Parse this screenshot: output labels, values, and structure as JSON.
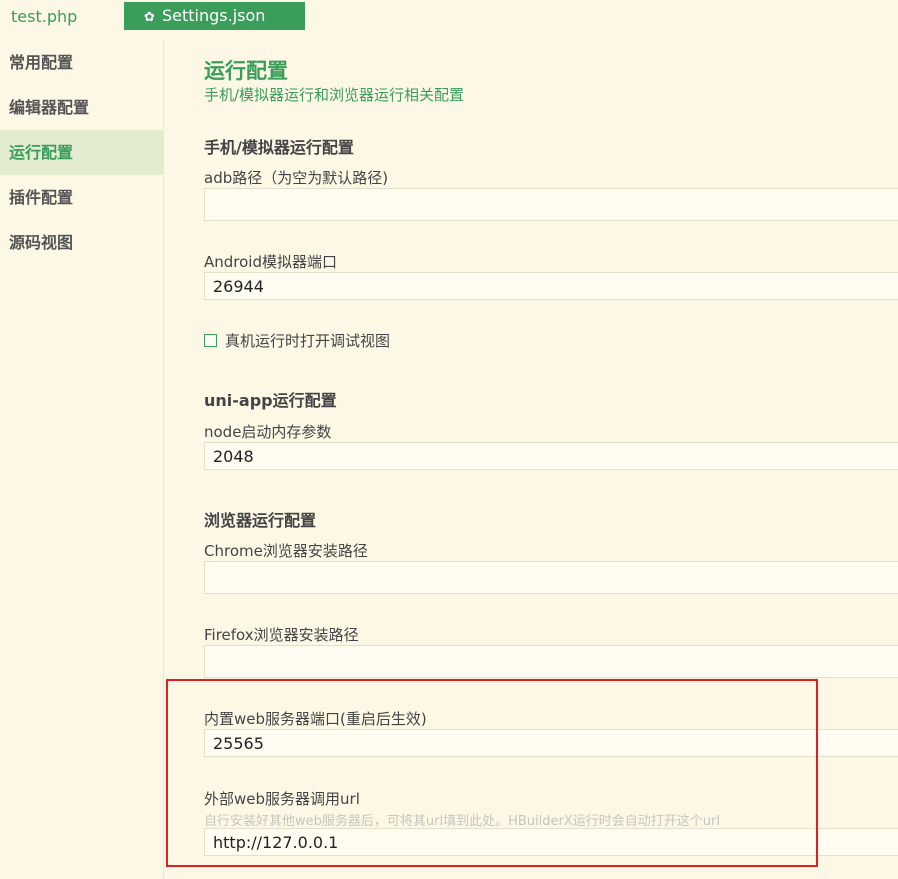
{
  "tabs": [
    {
      "label": "test.php"
    },
    {
      "label": "Settings.json",
      "icon": "gear-icon"
    }
  ],
  "sidebar": {
    "items": [
      {
        "label": "常用配置"
      },
      {
        "label": "编辑器配置"
      },
      {
        "label": "运行配置",
        "active": true
      },
      {
        "label": "插件配置"
      },
      {
        "label": "源码视图"
      }
    ]
  },
  "main": {
    "title": "运行配置",
    "subtitle": "手机/模拟器运行和浏览器运行相关配置",
    "sections": {
      "mobile": {
        "title": "手机/模拟器运行配置",
        "adb_label": "adb路径（为空为默认路径)",
        "adb_value": "",
        "android_port_label": "Android模拟器端口",
        "android_port_value": "26944",
        "debug_checkbox_label": "真机运行时打开调试视图",
        "debug_checked": false
      },
      "uniapp": {
        "title": "uni-app运行配置",
        "node_label": "node启动内存参数",
        "node_value": "2048"
      },
      "browser": {
        "title": "浏览器运行配置",
        "chrome_label": "Chrome浏览器安装路径",
        "chrome_value": "",
        "firefox_label": "Firefox浏览器安装路径",
        "firefox_value": "",
        "web_port_label": "内置web服务器端口(重启后生效)",
        "web_port_value": "25565",
        "external_url_label": "外部web服务器调用url",
        "external_url_hint": "自行安装好其他web服务器后，可将其url填到此处。HBuilderX运行时会自动打开这个url",
        "external_url_value": "http://127.0.0.1"
      }
    }
  },
  "colors": {
    "accent": "#3a9d5a",
    "background": "#fdf8e6",
    "highlight": "#e02020"
  }
}
